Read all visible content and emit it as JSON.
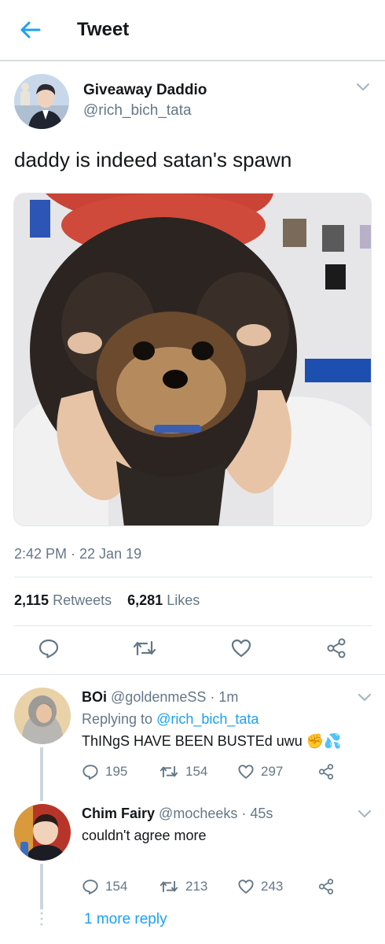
{
  "header": {
    "title": "Tweet",
    "back_icon": "arrow-left-icon"
  },
  "tweet": {
    "author_name": "Giveaway Daddio",
    "author_handle": "@rich_bich_tata",
    "text": "daddy is indeed satan's spawn",
    "timestamp": "2:42 PM · 22 Jan 19",
    "retweets_count": "2,115",
    "retweets_label": "Retweets",
    "likes_count": "6,281",
    "likes_label": "Likes"
  },
  "replies": [
    {
      "name": "BOi",
      "handle": "@goldenmeSS",
      "time": "· 1m",
      "replying_label": "Replying to",
      "replying_to": "@rich_bich_tata",
      "text": "ThINgS HAVE BEEN BUSTEd uwu",
      "emoji": "✊💦",
      "reply_count": "195",
      "retweet_count": "154",
      "like_count": "297"
    },
    {
      "name": "Chim Fairy",
      "handle": "@mocheeks",
      "time": "· 45s",
      "text": "couldn't agree more",
      "reply_count": "154",
      "retweet_count": "213",
      "like_count": "243"
    }
  ],
  "more_replies_label": "1 more reply",
  "colors": {
    "accent": "#1da1f2",
    "secondary_text": "#657786",
    "divider": "#e1e8ed"
  }
}
